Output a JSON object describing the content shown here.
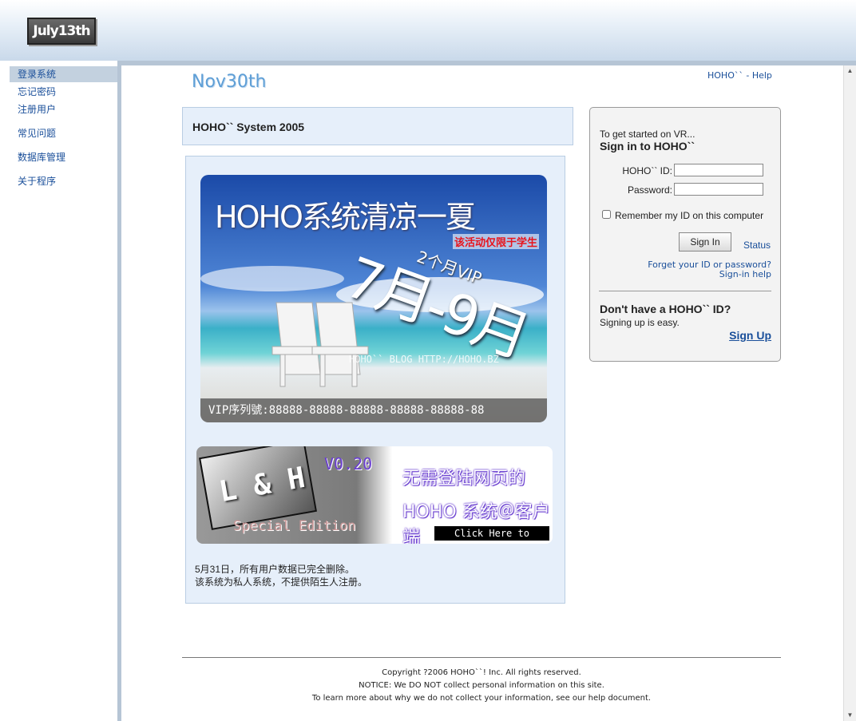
{
  "header": {
    "logo_text": "July13th"
  },
  "sidebar": {
    "items": [
      {
        "label": "登录系统",
        "active": true
      },
      {
        "label": "忘记密码"
      },
      {
        "label": "注册用户"
      },
      {
        "label": "常见问题"
      },
      {
        "label": "数据库管理"
      },
      {
        "label": "关于程序"
      }
    ]
  },
  "main": {
    "brand": "Nov30th",
    "help_link": "HOHO`` - Help",
    "system_title": "HOHO`` System 2005",
    "promo": {
      "title": "HOHO系统清凉一夏",
      "note": "该活动仅限于学生",
      "vip": "2个月VIP",
      "months": "7月-9月",
      "blog": "HOHO`` BLOG  HTTP://HOHO.BZ",
      "serial": "VIP序列號:88888-88888-88888-88888-88888-88"
    },
    "banner": {
      "lh": "L & H",
      "special": "Special Edition",
      "version": "V0.20",
      "line1": "无需登陆网页的",
      "line2": "HOHO 系统＠客户端",
      "download": "Click Here to DownLoad"
    },
    "notice_1": "5月31日，所有用户数据已完全删除。",
    "notice_2": "该系统为私人系统，不提供陌生人注册。"
  },
  "signin": {
    "intro": "To get started on VR...",
    "title": "Sign in to HOHO``",
    "id_label": "HOHO`` ID:",
    "id_value": "",
    "password_label": "Password:",
    "password_value": "",
    "remember_label": "Remember my ID on this computer",
    "remember_checked": false,
    "signin_button": "Sign In",
    "status_link": "Status",
    "forgot_link": "Forget your ID or password?",
    "help_link": "Sign-in help",
    "no_id_title": "Don't have a HOHO`` ID?",
    "signup_text": "Signing up is easy.",
    "signup_link": "Sign Up"
  },
  "footer": {
    "copyright": "Copyright ?2006 HOHO``! Inc. All rights reserved.",
    "notice": "NOTICE: We DO NOT collect personal information on this site.",
    "learn_more": "To learn more about why we do not collect your information, see our help document."
  },
  "colors": {
    "link": "#1a4f9a",
    "frame": "#b6c5d5",
    "panel_bg": "#e6effa",
    "sidebar_active": "#c3d1df"
  }
}
